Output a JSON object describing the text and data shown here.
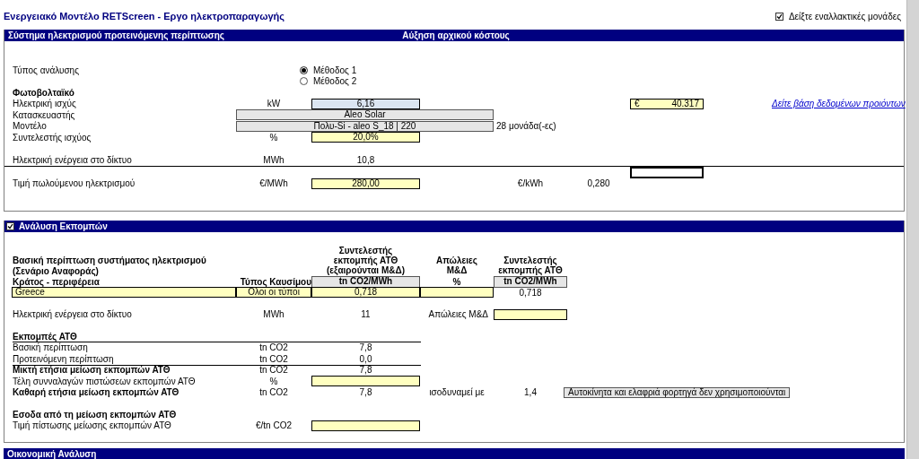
{
  "title": "Ενεργειακό Μοντέλο RETScreen - Εργο ηλεκτροπαραγωγής",
  "alt_units": {
    "label": "Δείξτε εναλλακτικές μονάδες",
    "checked": true
  },
  "proposed_system": {
    "heading": "Σύστημα ηλεκτρισμού προτεινόμενης περίπτωσης",
    "cost_heading": "Αύξηση αρχικού κόστους",
    "analysis_type": {
      "label": "Τύπος ανάλυσης",
      "options": [
        {
          "label": "Μέθοδος 1",
          "selected": true
        },
        {
          "label": "Μέθοδος 2",
          "selected": false
        }
      ]
    },
    "technology": "Φωτοβολταϊκό",
    "capacity": {
      "label": "Ηλεκτρική ισχύς",
      "unit": "kW",
      "value": "6,16",
      "cost_currency": "€",
      "cost": "40.317",
      "link": "Δείτε βάση δεδομένων προιόντων"
    },
    "manufacturer": {
      "label": "Κατασκευαστής",
      "value": "Aleo Solar"
    },
    "model": {
      "label": "Μοντέλο",
      "value": "Πολυ-Si - aleo S_18 | 220",
      "units": "28 μονάδα(-ες)"
    },
    "capacity_factor": {
      "label": "Συντελεστής ισχύος",
      "unit": "%",
      "value": "20,0%"
    },
    "grid_energy": {
      "label": "Ηλεκτρική ενέργεια στο δίκτυο",
      "unit": "MWh",
      "value": "10,8"
    },
    "export_rate": {
      "label": "Τιμή πωλούμενου ηλεκτρισμού",
      "unit": "€/MWh",
      "value": "280,00",
      "alt_unit": "€/kWh",
      "alt_value": "0,280"
    }
  },
  "emissions": {
    "expanded": true,
    "heading": "Ανάλυση Εκπομπών",
    "table_header": {
      "base_case": "Βασική περίπτωση συστήματος ηλεκτρισμού",
      "scenario": "(Σενάριο Αναφοράς)",
      "country": "Κράτος - περιφέρεια",
      "fuel_type": "Τύπος Καυσίμου",
      "factor_excl": "Συντελεστής εκπομπής ΑΤΘ (εξαιρούνται Μ&Δ)",
      "factor_excl_unit": "tn CO2/MWh",
      "losses": "Απώλειες Μ&Δ",
      "losses_unit": "%",
      "factor": "Συντελεστής εκπομπής ΑΤΘ",
      "factor_unit": "tn CO2/MWh"
    },
    "baseline": {
      "country": "Greece",
      "fuel_type": "Ολοι οι τύποι",
      "factor_excl": "0,718",
      "factor": "0,718"
    },
    "grid_energy": {
      "label": "Ηλεκτρική ενέργεια στο δίκτυο",
      "unit": "MWh",
      "value": "11",
      "losses_label": "Απώλειες Μ&Δ"
    },
    "ghg": {
      "heading": "Εκπομπές ΑΤΘ",
      "rows": [
        {
          "kind": "item",
          "label": "Βασική περίπτωση",
          "unit": "tn CO2",
          "value": "7,8"
        },
        {
          "kind": "item",
          "label": "Προτεινόμενη περίπτωση",
          "unit": "tn CO2",
          "value": "0,0"
        },
        {
          "kind": "subtotal",
          "label": "Μικτή ετήσια μείωση εκπομπών ΑΤΘ",
          "unit": "tn CO2",
          "value": "7,8"
        },
        {
          "kind": "input",
          "label": "Τέλη συνναλαγών πιστώσεων εκπομπών ΑΤΘ",
          "unit": "%"
        },
        {
          "kind": "total",
          "label": "Καθαρή ετήσια μείωση εκπομπών ΑΤΘ",
          "unit": "tn CO2",
          "value": "7,8",
          "equivalent_label": "ισοδυναμεί με",
          "equivalent_value": "1,4",
          "equivalent_item": "Αυτοκίνητα και ελαφριά φορτηγά δεν χρησιμοποιούνται"
        }
      ]
    },
    "revenue": {
      "heading": "Εσοδα από τη μείωση εκπομπών ΑΤΘ",
      "label": "Τιμή πίστωσης μείωσης εκπομπών ΑΤΘ",
      "unit": "€/tn CO2"
    }
  },
  "economic": {
    "heading": "Οικονομική Ανάλυση"
  }
}
